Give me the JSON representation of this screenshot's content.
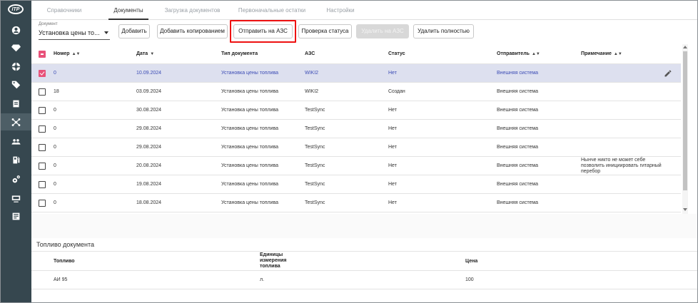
{
  "nav": {
    "logo": "ITP",
    "icons": [
      "user-icon",
      "diamond-icon",
      "settings-wheel-icon",
      "tag-icon",
      "document-icon",
      "network-icon",
      "group-icon",
      "fuel-pump-icon",
      "gears-icon",
      "monitor-icon",
      "notebook-icon"
    ],
    "active_index": 5
  },
  "tabs": [
    "Справочники",
    "Документы",
    "Загрузка документов",
    "Первоначальные остатки",
    "Настройки"
  ],
  "active_tab": "Документы",
  "toolbar": {
    "doc_label": "Документ",
    "doc_value": "Установка цены то...",
    "add": "Добавить",
    "add_copy": "Добавить копированием",
    "send": "Отправить на АЗС",
    "check_status": "Проверка статуса",
    "delete_on_station": "Удалить на АЗС",
    "delete_full": "Удалить полностью"
  },
  "table": {
    "headers": {
      "number": "Номер",
      "date": "Дата",
      "doc_type": "Тип документа",
      "station": "АЗС",
      "status": "Статус",
      "sender": "Отправитель",
      "note": "Примечание"
    },
    "rows": [
      {
        "number": "0",
        "date": "10.09.2024",
        "type": "Установка цены топлива",
        "station": "WIKI2",
        "status": "Нет",
        "sender": "Внешняя система",
        "note": "",
        "selected": true
      },
      {
        "number": "18",
        "date": "03.09.2024",
        "type": "Установка цены топлива",
        "station": "WIKI2",
        "status": "Создан",
        "sender": "Внешняя система",
        "note": "",
        "selected": false
      },
      {
        "number": "0",
        "date": "30.08.2024",
        "type": "Установка цены топлива",
        "station": "TestSync",
        "status": "Нет",
        "sender": "Внешняя система",
        "note": "",
        "selected": false
      },
      {
        "number": "0",
        "date": "29.08.2024",
        "type": "Установка цены топлива",
        "station": "TestSync",
        "status": "Нет",
        "sender": "Внешняя система",
        "note": "",
        "selected": false
      },
      {
        "number": "0",
        "date": "29.08.2024",
        "type": "Установка цены топлива",
        "station": "TestSync",
        "status": "Нет",
        "sender": "Внешняя система",
        "note": "",
        "selected": false
      },
      {
        "number": "0",
        "date": "20.08.2024",
        "type": "Установка цены топлива",
        "station": "TestSync",
        "status": "Нет",
        "sender": "Внешняя система",
        "note": "Нынче никто не может себе позволить инициировать гитарный перебор",
        "selected": false
      },
      {
        "number": "0",
        "date": "19.08.2024",
        "type": "Установка цены топлива",
        "station": "TestSync",
        "status": "Нет",
        "sender": "Внешняя система",
        "note": "",
        "selected": false
      },
      {
        "number": "0",
        "date": "18.08.2024",
        "type": "Установка цены топлива",
        "station": "TestSync",
        "status": "Нет",
        "sender": "Внешняя система",
        "note": "",
        "selected": false
      }
    ]
  },
  "fuel": {
    "title": "Топливо документа",
    "headers": {
      "fuel": "Топливо",
      "unit": "Единицы измерения топлива",
      "price": "Цена"
    },
    "rows": [
      {
        "fuel": "АИ 95",
        "unit": "л.",
        "price": "100"
      }
    ]
  },
  "colors": {
    "sidebar": "#36474f",
    "accent": "#e8527a",
    "selected_row": "#dde0ef",
    "link_text": "#3c4cb5",
    "highlight": "#ee1111"
  }
}
